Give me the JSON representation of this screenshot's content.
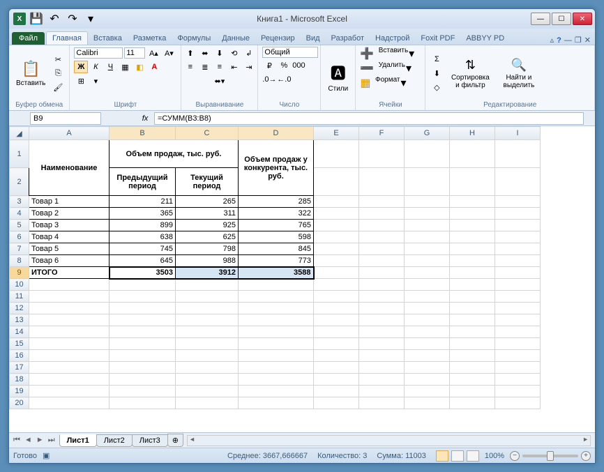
{
  "title": "Книга1  -  Microsoft Excel",
  "tabs": {
    "file": "Файл",
    "items": [
      "Главная",
      "Вставка",
      "Разметка",
      "Формулы",
      "Данные",
      "Рецензир",
      "Вид",
      "Разработ",
      "Надстрой",
      "Foxit PDF",
      "ABBYY PD"
    ],
    "active": 0
  },
  "ribbon": {
    "clipboard": {
      "paste": "Вставить",
      "label": "Буфер обмена"
    },
    "font": {
      "name": "Calibri",
      "size": "11",
      "label": "Шрифт"
    },
    "alignment": {
      "label": "Выравнивание"
    },
    "number": {
      "format": "Общий",
      "label": "Число"
    },
    "styles": {
      "btn": "Стили"
    },
    "cells": {
      "insert": "Вставить",
      "delete": "Удалить",
      "format": "Формат",
      "label": "Ячейки"
    },
    "editing": {
      "sort": "Сортировка и фильтр",
      "find": "Найти и выделить",
      "label": "Редактирование"
    }
  },
  "nameBox": "B9",
  "formula": "=СУММ(B3:B8)",
  "columns": [
    "A",
    "B",
    "C",
    "D",
    "E",
    "F",
    "G",
    "H",
    "I"
  ],
  "data": {
    "h1_merged": "Объем продаж, тыс. руб.",
    "h1_a": "Наименование",
    "h1_d": "Объем продаж у конкурента, тыс. руб.",
    "h2_b": "Предыдущий период",
    "h2_c": "Текущий период",
    "rows": [
      {
        "a": "Товар 1",
        "b": "211",
        "c": "265",
        "d": "285"
      },
      {
        "a": "Товар 2",
        "b": "365",
        "c": "311",
        "d": "322"
      },
      {
        "a": "Товар 3",
        "b": "899",
        "c": "925",
        "d": "765"
      },
      {
        "a": "Товар 4",
        "b": "638",
        "c": "625",
        "d": "598"
      },
      {
        "a": "Товар 5",
        "b": "745",
        "c": "798",
        "d": "845"
      },
      {
        "a": "Товар 6",
        "b": "645",
        "c": "988",
        "d": "773"
      }
    ],
    "total": {
      "a": "ИТОГО",
      "b": "3503",
      "c": "3912",
      "d": "3588"
    }
  },
  "sheets": [
    "Лист1",
    "Лист2",
    "Лист3"
  ],
  "status": {
    "ready": "Готово",
    "avg_label": "Среднее:",
    "avg": "3667,666667",
    "count_label": "Количество:",
    "count": "3",
    "sum_label": "Сумма:",
    "sum": "11003",
    "zoom": "100%"
  }
}
